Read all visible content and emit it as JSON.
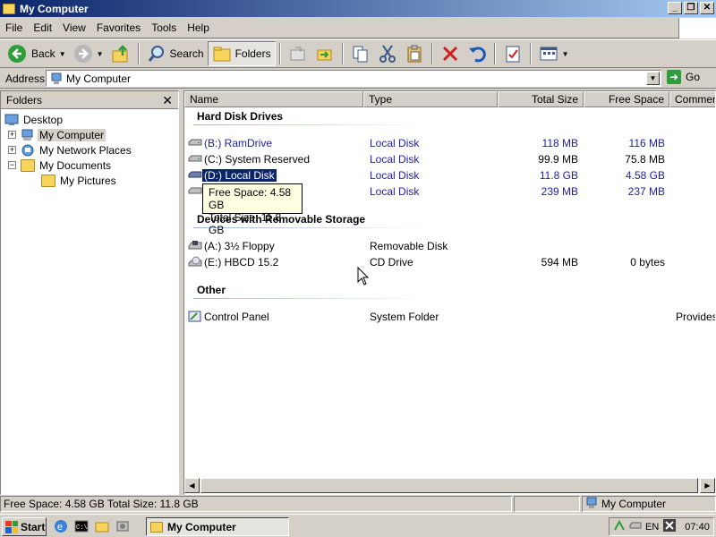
{
  "window": {
    "title": "My Computer"
  },
  "menu": [
    "File",
    "Edit",
    "View",
    "Favorites",
    "Tools",
    "Help"
  ],
  "toolbar": {
    "back_label": "Back",
    "search_label": "Search",
    "folders_label": "Folders"
  },
  "address": {
    "label": "Address",
    "value": "My Computer",
    "go_label": "Go"
  },
  "folders": {
    "header": "Folders",
    "items": [
      {
        "label": "Desktop"
      },
      {
        "label": "My Computer"
      },
      {
        "label": "My Network Places"
      },
      {
        "label": "My Documents"
      },
      {
        "label": "My Pictures"
      }
    ]
  },
  "columns": [
    "Name",
    "Type",
    "Total Size",
    "Free Space",
    "Comment"
  ],
  "groups": [
    {
      "title": "Hard Disk Drives",
      "items": [
        {
          "name": "(B:) RamDrive",
          "type": "Local Disk",
          "total": "118 MB",
          "free": "116 MB",
          "comment": ""
        },
        {
          "name": "(C:) System Reserved",
          "type": "Local Disk",
          "total": "99.9 MB",
          "free": "75.8 MB",
          "comment": ""
        },
        {
          "name": "(D:) Local Disk",
          "type": "Local Disk",
          "total": "11.8 GB",
          "free": "4.58 GB",
          "comment": ""
        },
        {
          "name": "",
          "type": "Local Disk",
          "total": "239 MB",
          "free": "237 MB",
          "comment": ""
        }
      ]
    },
    {
      "title": "Devices with Removable Storage",
      "items": [
        {
          "name": "(A:) 3½ Floppy",
          "type": "Removable Disk",
          "total": "",
          "free": "",
          "comment": ""
        },
        {
          "name": "(E:) HBCD 15.2",
          "type": "CD Drive",
          "total": "594 MB",
          "free": "0 bytes",
          "comment": ""
        }
      ]
    },
    {
      "title": "Other",
      "items": [
        {
          "name": "Control Panel",
          "type": "System Folder",
          "total": "",
          "free": "",
          "comment": "Provides"
        }
      ]
    }
  ],
  "tooltip": {
    "line1": "Free Space: 4.58 GB",
    "line2": "Total Size: 11.8 GB"
  },
  "status": {
    "left": "Free Space: 4.58 GB Total Size: 11.8 GB",
    "zone": "My Computer"
  },
  "taskbar": {
    "start_label": "Start",
    "task_label": "My Computer",
    "lang": "EN",
    "clock": "07:40"
  },
  "colors": {
    "title_gradient_start": "#0a246a",
    "title_gradient_end": "#a6caf0",
    "selection": "#0a246a",
    "drive_link": "#2020a8"
  }
}
